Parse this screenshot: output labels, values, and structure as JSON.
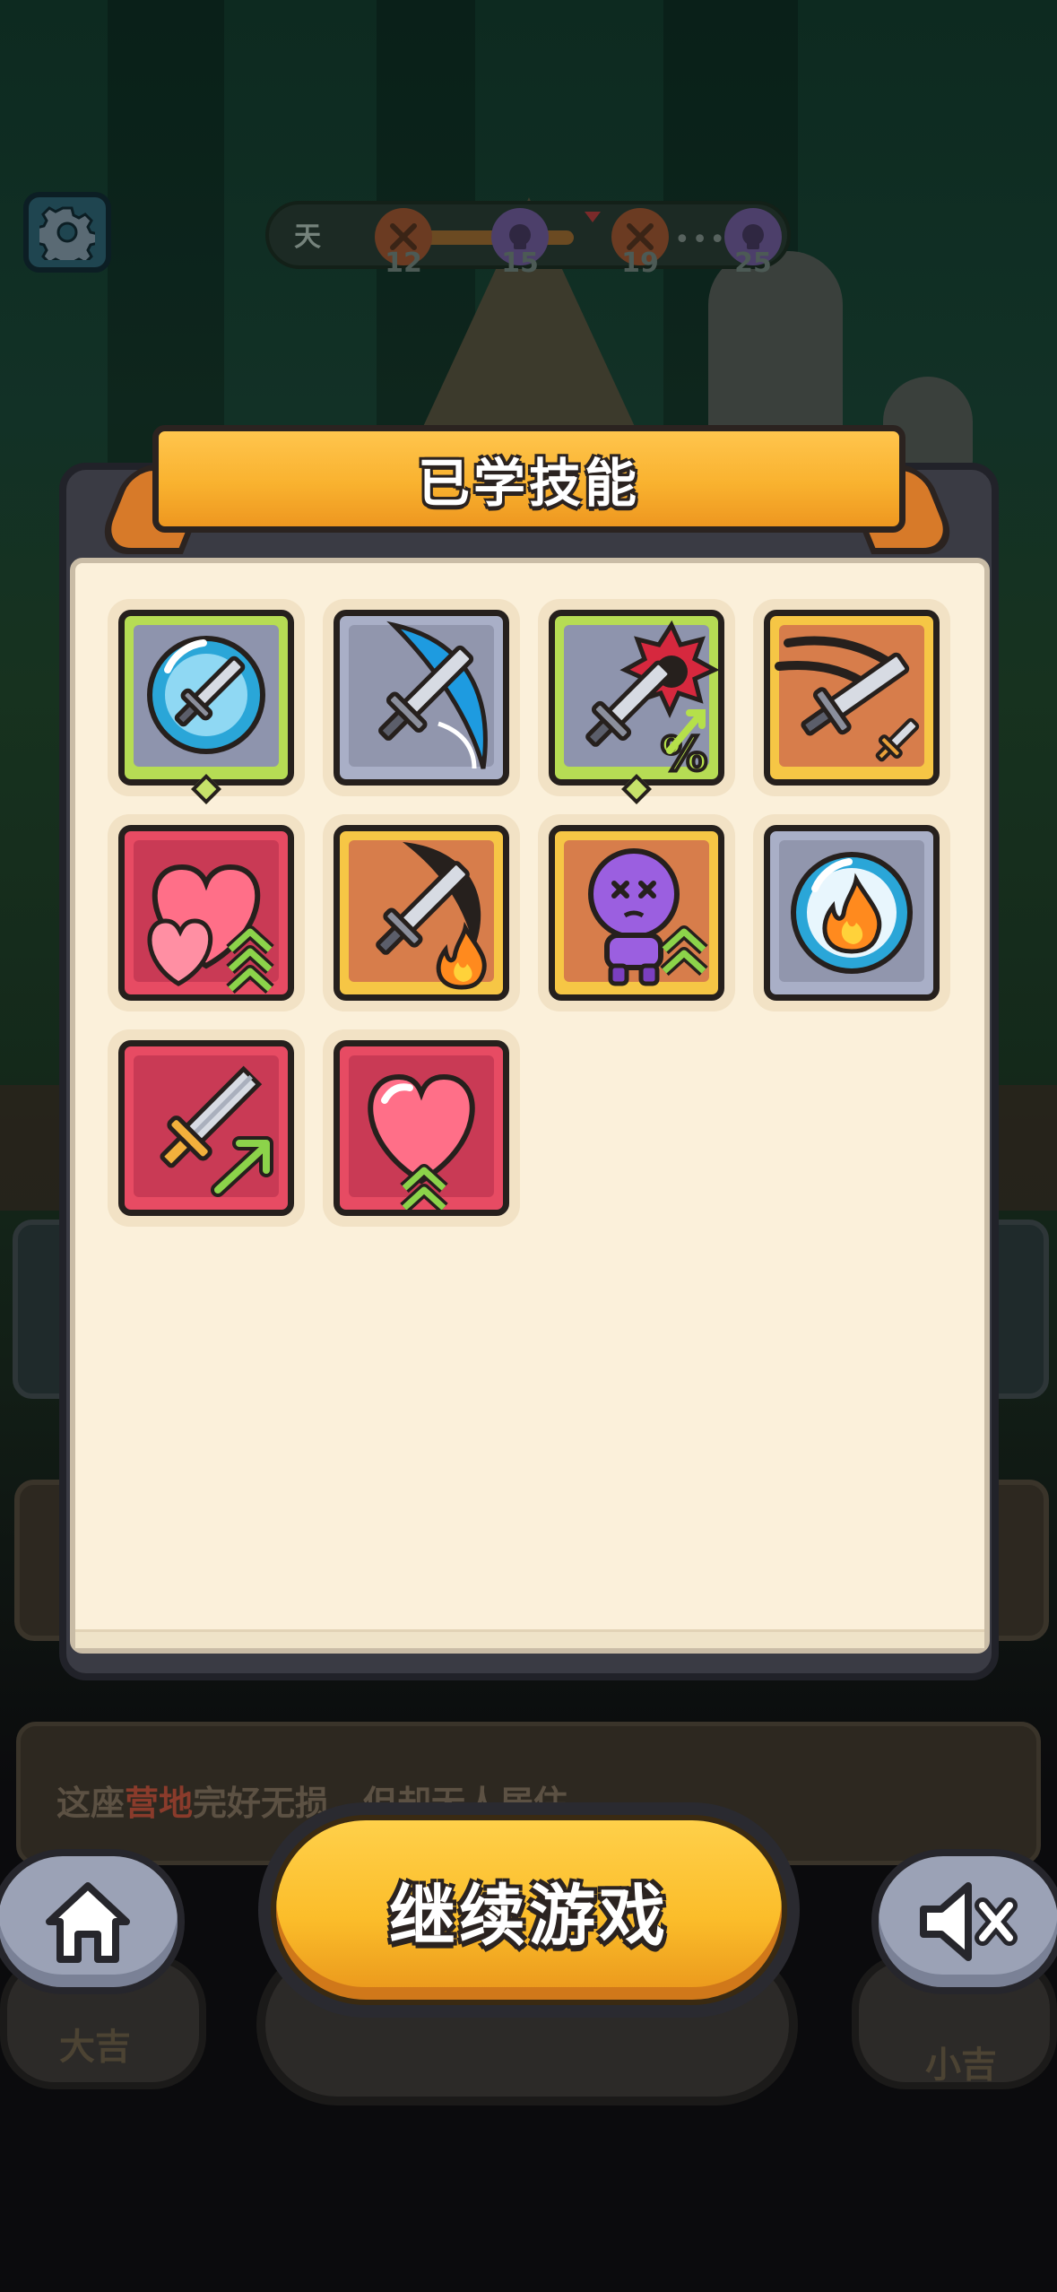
{
  "hud": {
    "day_label": "天",
    "milestones": [
      "12",
      "15",
      "19",
      "25"
    ],
    "ellipsis": "•••"
  },
  "background": {
    "status_text_pre": "这座",
    "status_text_highlight": "营地",
    "status_text_post": "完好无损，但却无人居住",
    "left_fortune": "大吉",
    "right_fortune": "小吉"
  },
  "modal": {
    "title": "已学技能",
    "skills": [
      {
        "icon": "sword-in-blue-orb-icon",
        "frame": "green",
        "gem": true
      },
      {
        "icon": "sword-blue-slash-icon",
        "frame": "grey",
        "gem": false
      },
      {
        "icon": "sword-critical-percent-icon",
        "frame": "green",
        "gem": true
      },
      {
        "icon": "sword-dash-dagger-icon",
        "frame": "gold",
        "gem": false
      },
      {
        "icon": "double-heart-upgrade-icon",
        "frame": "red",
        "gem": false
      },
      {
        "icon": "sword-fire-icon",
        "frame": "gold",
        "gem": false
      },
      {
        "icon": "purple-doll-upgrade-icon",
        "frame": "gold",
        "gem": false
      },
      {
        "icon": "fire-orb-icon",
        "frame": "grey",
        "gem": false
      },
      {
        "icon": "sword-upgrade-arrow-icon",
        "frame": "red",
        "gem": false
      },
      {
        "icon": "heart-upgrade-icon",
        "frame": "red",
        "gem": false
      }
    ]
  },
  "buttons": {
    "continue_label": "继续游戏",
    "home_icon": "home-icon",
    "mute_icon": "mute-icon",
    "settings_icon": "gear-icon"
  },
  "colors": {
    "banner": "#f9b22f",
    "continue": "#fbbd2a",
    "panel": "#fbf0da"
  }
}
